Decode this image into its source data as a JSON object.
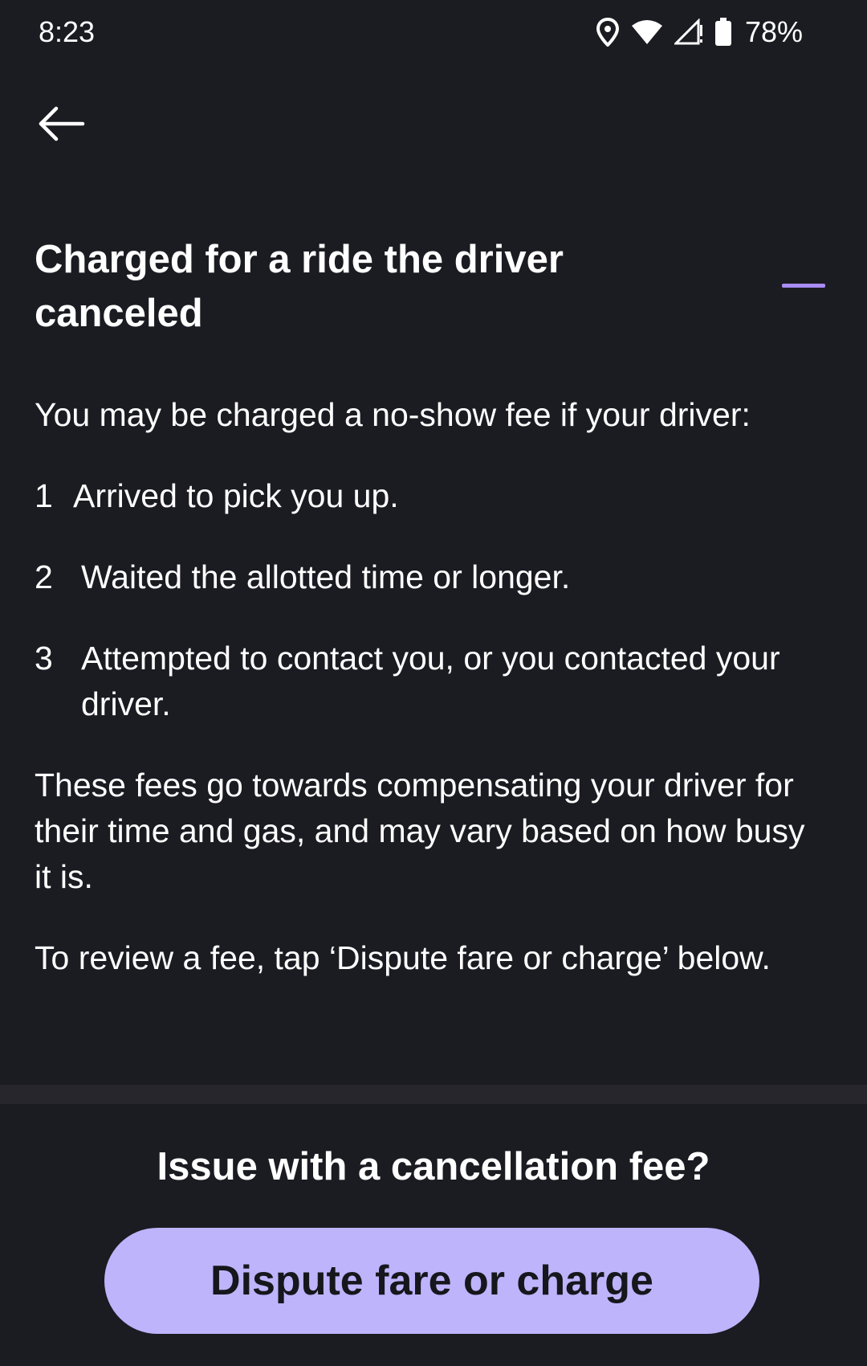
{
  "status_bar": {
    "time": "8:23",
    "battery_percent": "78%",
    "icons": [
      "location-icon",
      "wifi-icon",
      "cellular-no-signal-icon",
      "battery-icon"
    ]
  },
  "nav": {
    "back_icon": "arrow-left-icon"
  },
  "article": {
    "title": "Charged for a ride the driver canceled",
    "intro": "You may be charged a no-show fee if your driver:",
    "steps": [
      {
        "number": "1",
        "text": "Arrived to pick you up."
      },
      {
        "number": "2",
        "text": "Waited the allotted time or longer."
      },
      {
        "number": "3",
        "text": "Attempted to contact you, or you contacted your driver."
      }
    ],
    "paragraph_fees": "These fees go towards compensating your driver for their time and gas, and may vary based on how busy it is.",
    "paragraph_review": "To review a fee, tap ‘Dispute fare or charge’ below."
  },
  "footer": {
    "heading": "Issue with a cancellation fee?",
    "dispute_button_label": "Dispute fare or charge"
  },
  "colors": {
    "background": "#1b1b22",
    "accent": "#a98cf5",
    "button": "#bdb4fb",
    "button_text": "#16161c",
    "divider": "#26262c"
  }
}
